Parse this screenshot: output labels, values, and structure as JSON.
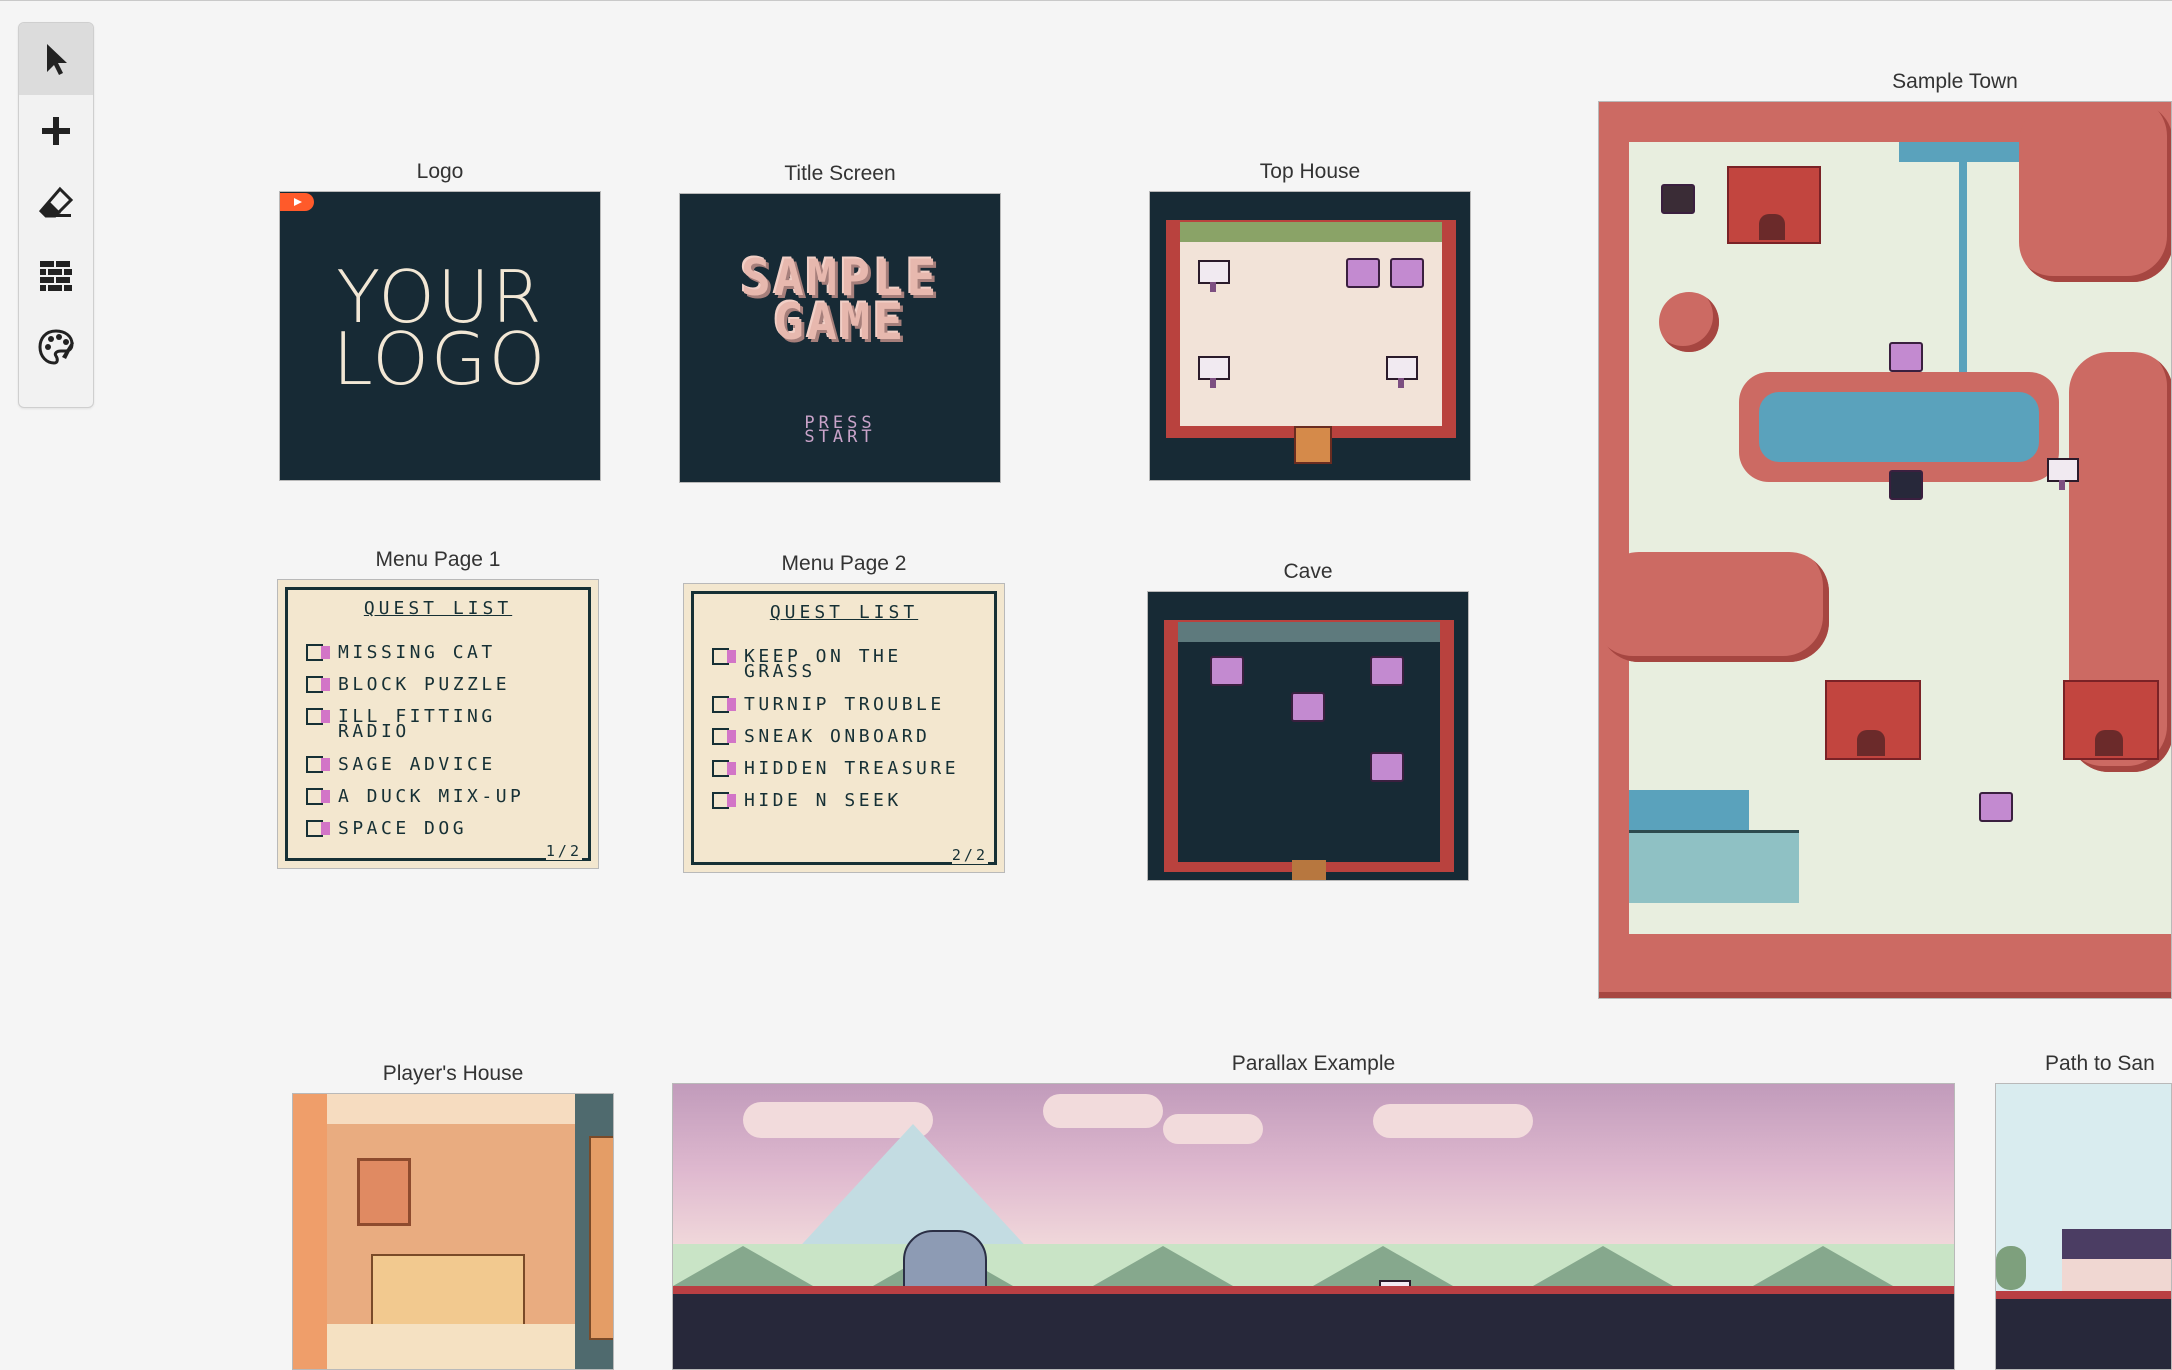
{
  "toolbar": {
    "tools": [
      {
        "name": "select",
        "icon": "cursor-arrow-icon",
        "active": true
      },
      {
        "name": "add",
        "icon": "plus-icon"
      },
      {
        "name": "eraser",
        "icon": "eraser-icon"
      },
      {
        "name": "collisions",
        "icon": "bricks-icon"
      },
      {
        "name": "colors",
        "icon": "palette-icon"
      }
    ]
  },
  "scenes": {
    "logo": {
      "title": "Logo",
      "text_line1": "YOUR",
      "text_line2": "LOGO"
    },
    "title_screen": {
      "title": "Title Screen",
      "game_line1": "SAMPLE",
      "game_line2": "GAME",
      "press_line1": "PRESS",
      "press_line2": "START"
    },
    "top_house": {
      "title": "Top House"
    },
    "sample_town": {
      "title": "Sample Town"
    },
    "menu_page_1": {
      "title": "Menu Page 1",
      "heading": "QUEST LIST",
      "items": [
        "MISSING CAT",
        "BLOCK PUZZLE",
        "ILL FITTING\nRADIO",
        "SAGE ADVICE",
        "A DUCK MIX-UP",
        "SPACE DOG"
      ],
      "page": "1/2"
    },
    "menu_page_2": {
      "title": "Menu Page 2",
      "heading": "QUEST LIST",
      "items": [
        "KEEP ON THE\nGRASS",
        "TURNIP TROUBLE",
        "SNEAK ONBOARD",
        "HIDDEN TREASURE",
        "HIDE N SEEK"
      ],
      "page": "2/2"
    },
    "cave": {
      "title": "Cave"
    },
    "players_house": {
      "title": "Player's House"
    },
    "parallax": {
      "title": "Parallax Example"
    },
    "path": {
      "title": "Path to San"
    }
  },
  "colors": {
    "canvas_bg": "#f5f5f5",
    "scene_dark": "#172a35",
    "menu_paper": "#f3e7cf",
    "accent_red": "#b9423e",
    "accent_pink": "#d275c7"
  }
}
